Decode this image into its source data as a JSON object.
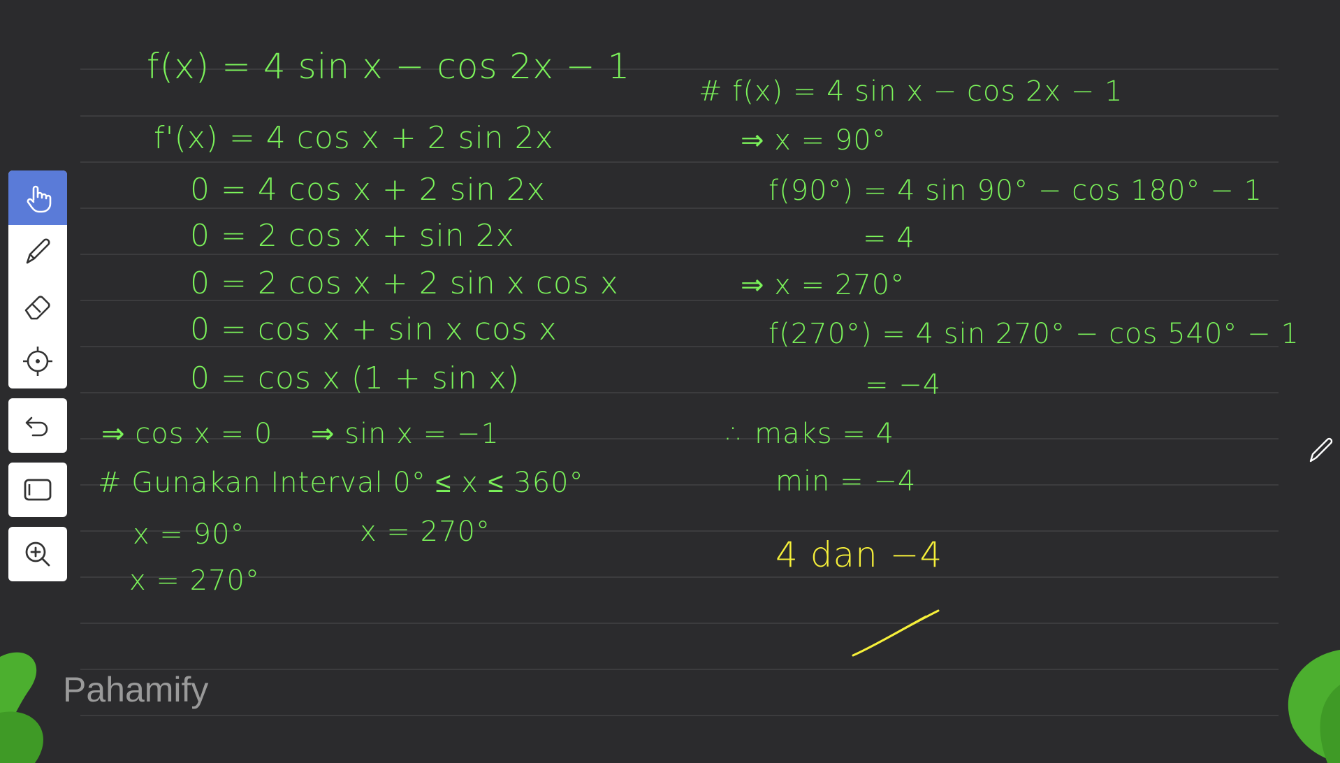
{
  "left_solution": [
    "f(x) = 4 sin x − cos 2x − 1",
    "f'(x) = 4 cos x + 2 sin 2x",
    "0 = 4 cos x + 2 sin 2x",
    "0 = 2 cos x + sin 2x",
    "0 = 2 cos x + 2 sin x cos x",
    "0 = cos x + sin x cos x",
    "0 = cos x (1 + sin x)"
  ],
  "cases": {
    "case_a": "⇒ cos x = 0",
    "case_b": "⇒ sin x = −1"
  },
  "interval": {
    "title": "# Gunakan Interval  0° ≤ x ≤ 360°",
    "x1": "x = 90°",
    "x2": "x = 270°",
    "x3": "x = 270°"
  },
  "right_solution": {
    "title": "# f(x) = 4 sin x − cos 2x − 1",
    "step1": "⇒ x = 90°",
    "step2": "f(90°) = 4 sin 90° − cos 180° − 1",
    "step3": "= 4",
    "step4": "⇒ x = 270°",
    "step5": "f(270°) = 4 sin 270° − cos 540° − 1",
    "step6": "= −4",
    "maks": "∴ maks = 4",
    "min": "min = −4",
    "answer": "4 dan −4"
  },
  "toolbar": {
    "icons": [
      "hand-pointer-icon",
      "pen-icon",
      "eraser-icon",
      "move-icon",
      "undo-icon",
      "rectangle-icon",
      "zoom-in-icon"
    ],
    "active": "hand-pointer-icon"
  },
  "brand": {
    "logo_text": "Pahamify"
  },
  "colors": {
    "background": "#2b2b2d",
    "ink_green": "#7bf25a",
    "ink_yellow": "#f6f03a",
    "toolbar_active": "#5a7bd8",
    "leaf": "#4caf2f"
  }
}
